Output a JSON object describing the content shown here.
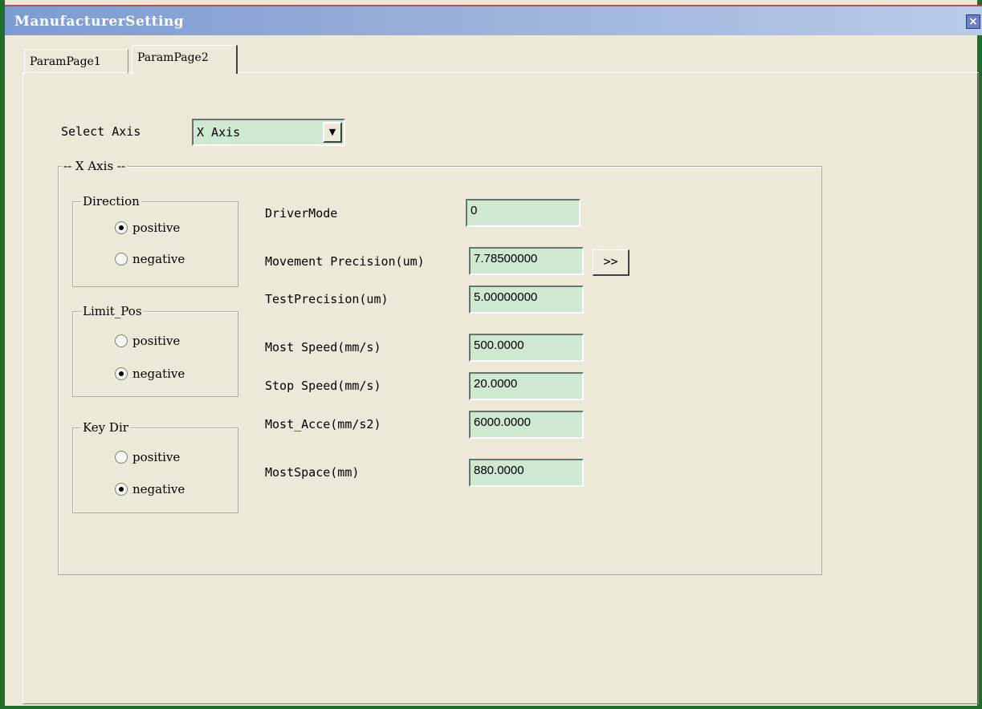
{
  "window": {
    "title": "ManufacturerSetting",
    "close_glyph": "×"
  },
  "tabs": [
    {
      "label": "ParamPage1",
      "active": false
    },
    {
      "label": "ParamPage2",
      "active": true
    }
  ],
  "select_axis": {
    "label": "Select Axis",
    "value": "X Axis",
    "arrow_glyph": "▼"
  },
  "axis_group": {
    "title": "-- X Axis --"
  },
  "direction": {
    "title": "Direction",
    "options": [
      "positive",
      "negative"
    ],
    "selected": "positive"
  },
  "limit_pos": {
    "title": "Limit_Pos",
    "options": [
      "positive",
      "negative"
    ],
    "selected": "negative"
  },
  "key_dir": {
    "title": "Key Dir",
    "options": [
      "positive",
      "negative"
    ],
    "selected": "negative"
  },
  "params": [
    {
      "label": "DriverMode",
      "value": "0"
    },
    {
      "label": "Movement Precision(um)",
      "value": "7.78500000"
    },
    {
      "label": "TestPrecision(um)",
      "value": "5.00000000"
    },
    {
      "label": "Most Speed(mm/s)",
      "value": "500.0000"
    },
    {
      "label": "Stop Speed(mm/s)",
      "value": "20.0000"
    },
    {
      "label": "Most_Acce(mm/s2)",
      "value": "6000.0000"
    },
    {
      "label": "MostSpace(mm)",
      "value": "880.0000"
    }
  ],
  "more_button": {
    "label": ">>"
  }
}
